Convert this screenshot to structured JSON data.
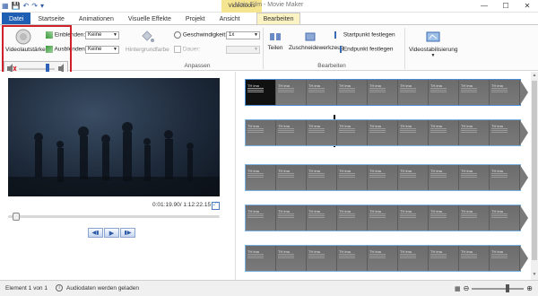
{
  "window": {
    "title": "Mein Film - Movie Maker",
    "context_tab_group": "Videotools",
    "buttons": [
      "—",
      "☐",
      "✕"
    ]
  },
  "tabs": [
    {
      "label": "Datei"
    },
    {
      "label": "Startseite"
    },
    {
      "label": "Animationen"
    },
    {
      "label": "Visuelle Effekte"
    },
    {
      "label": "Projekt"
    },
    {
      "label": "Ansicht"
    },
    {
      "label": "Bearbeiten"
    }
  ],
  "ribbon": {
    "volume_label": "Videolautstärke",
    "fade_in_label": "Einblenden:",
    "fade_in_value": "Keine",
    "fade_out_label": "Ausblenden:",
    "fade_out_value": "Keine",
    "bg_color_label": "Hintergrundfarbe",
    "speed_label": "Geschwindigkeit:",
    "speed_value": "1x",
    "duration_label": "Dauer:",
    "duration_value": "",
    "group_adjust": "Anpassen",
    "split_label": "Teilen",
    "trim_label": "Zuschneidewerkzeug",
    "set_start_label": "Startpunkt festlegen",
    "set_end_label": "Endpunkt festlegen",
    "group_edit": "Bearbeiten",
    "stabilize_label": "Videostabilisierung"
  },
  "preview": {
    "time": "0:01:19.90/ 1:12:22.15",
    "seek_position": 0.02
  },
  "timeline": {
    "frame_text": "TH ima",
    "strips": 5,
    "frames_per_strip": 9
  },
  "status": {
    "item": "Element 1 von 1",
    "message": "Audiodaten werden geladen",
    "zoom_level": 0.7
  }
}
